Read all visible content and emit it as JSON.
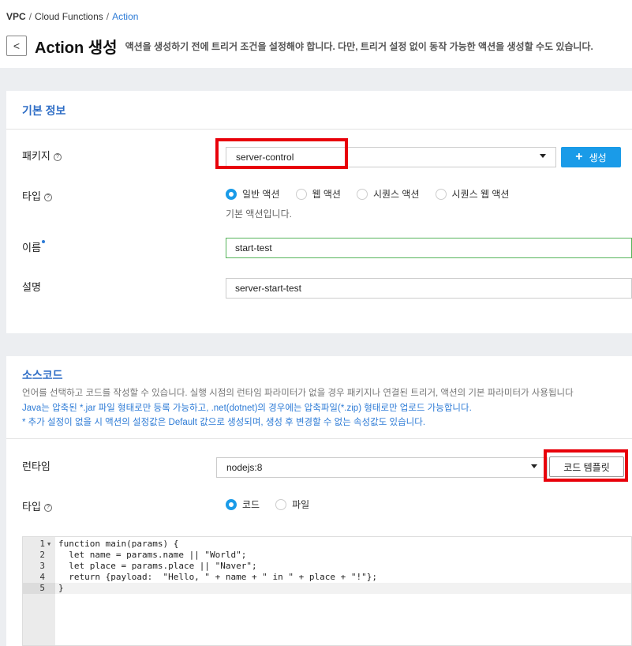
{
  "breadcrumb": {
    "vpc": "VPC",
    "cloud_functions": "Cloud Functions",
    "current": "Action",
    "separator": "/"
  },
  "header": {
    "back_glyph": "<",
    "title": "Action 생성",
    "description": "액션을 생성하기 전에 트리거 조건을 설정해야 합니다. 다만, 트리거 설정 없이 동작 가능한 액션을 생성할 수도 있습니다."
  },
  "basic_info": {
    "title": "기본 정보",
    "package_label": "패키지",
    "package_value": "server-control",
    "create_button": "생성",
    "type_label": "타입",
    "type_options": [
      "일반 액션",
      "웹 액션",
      "시퀀스 액션",
      "시퀀스 웹 액션"
    ],
    "type_selected_index": 0,
    "type_hint": "기본 액션입니다.",
    "name_label": "이름",
    "name_value": "start-test",
    "desc_label": "설명",
    "desc_value": "server-start-test"
  },
  "source": {
    "title": "소스코드",
    "desc1": "언어를 선택하고 코드를 작성할 수 있습니다. 실행 시점의 런타임 파라미터가 없을 경우 패키지나 연결된 트리거, 액션의 기본 파라미터가 사용됩니다",
    "desc2": "Java는 압축된 *.jar 파일 형태로만 등록 가능하고, .net(dotnet)의 경우에는 압축파일(*.zip) 형태로만 업로드 가능합니다.",
    "desc3": "* 추가 설정이 없을 시 액션의 설정값은 Default 값으로 생성되며, 생성 후 변경할 수 없는 속성값도 있습니다.",
    "runtime_label": "런타임",
    "runtime_value": "nodejs:8",
    "template_button": "코드 템플릿",
    "type_label": "타입",
    "type_options": [
      "코드",
      "파일"
    ],
    "type_selected_index": 0
  },
  "editor": {
    "lines": [
      {
        "num": "1",
        "code": "function main(params) {"
      },
      {
        "num": "2",
        "code": "  let name = params.name || \"World\";"
      },
      {
        "num": "3",
        "code": "  let place = params.place || \"Naver\";"
      },
      {
        "num": "4",
        "code": "  return {payload:  \"Hello, \" + name + \" in \" + place + \"!\"};"
      },
      {
        "num": "5",
        "code": "}"
      }
    ]
  },
  "icons": {
    "help": "?",
    "plus": "+"
  },
  "colors": {
    "accent": "#1a9be8",
    "highlight_box": "#e8000a",
    "link": "#2d7bd6",
    "valid_border": "#56b45a"
  }
}
